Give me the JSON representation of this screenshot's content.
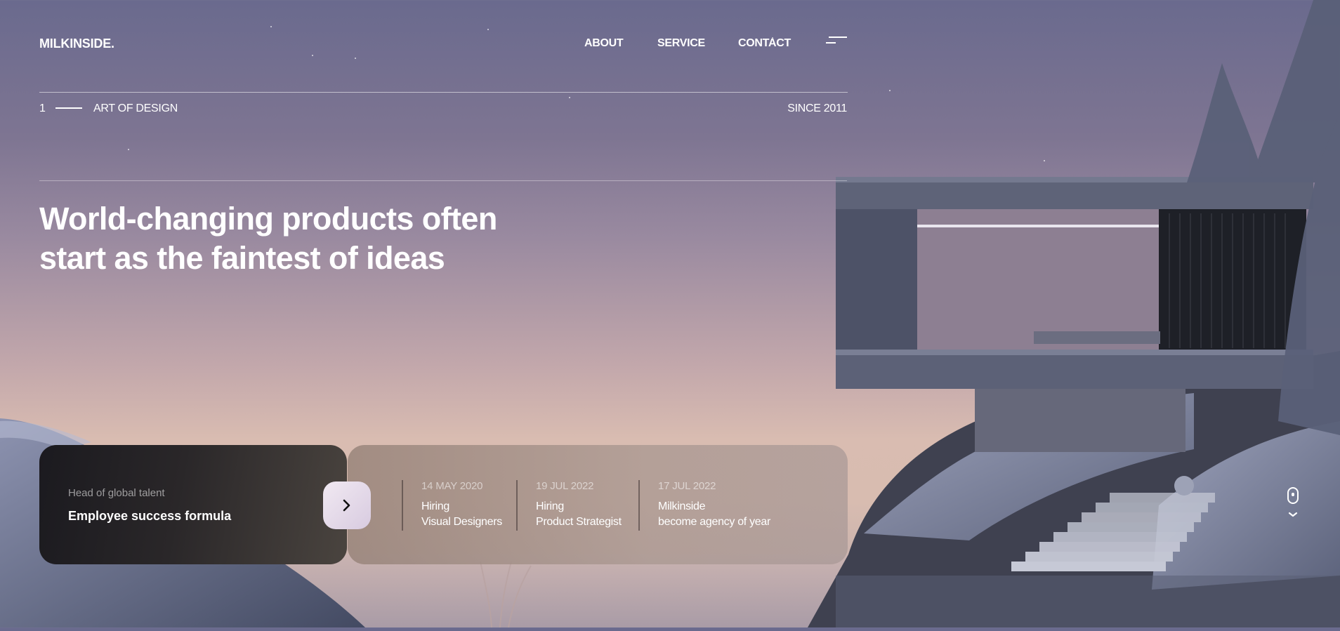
{
  "brand": {
    "logo": "MILKINSIDE."
  },
  "nav": {
    "about": "ABOUT",
    "service": "SERVICE",
    "contact": "CONTACT",
    "menu_icon": "hamburger-menu-icon"
  },
  "hero": {
    "index": "1",
    "tagline": "ART OF DESIGN",
    "since": "SINCE 2011",
    "headline_line1": "World-changing products often",
    "headline_line2": "start as the faintest of ideas"
  },
  "feature_card": {
    "caption": "Head of global talent",
    "title": "Employee success formula",
    "button_icon": "chevron-right-icon"
  },
  "news": [
    {
      "date": "14 MAY 2020",
      "line1": "Hiring",
      "line2": "Visual Designers"
    },
    {
      "date": "19 JUL 2022",
      "line1": "Hiring",
      "line2": "Product Strategist"
    },
    {
      "date": "17 JUL 2022",
      "line1": "Milkinside",
      "line2": "become agency of year"
    }
  ],
  "scroll": {
    "icon": "mouse-scroll-icon",
    "chevron": "chevron-down-icon"
  },
  "colors": {
    "sky_top": "#6a6a8e",
    "sky_horizon": "#d9bcb1",
    "card_dark": "#1b1a1f",
    "button": "#e6dbe9"
  }
}
